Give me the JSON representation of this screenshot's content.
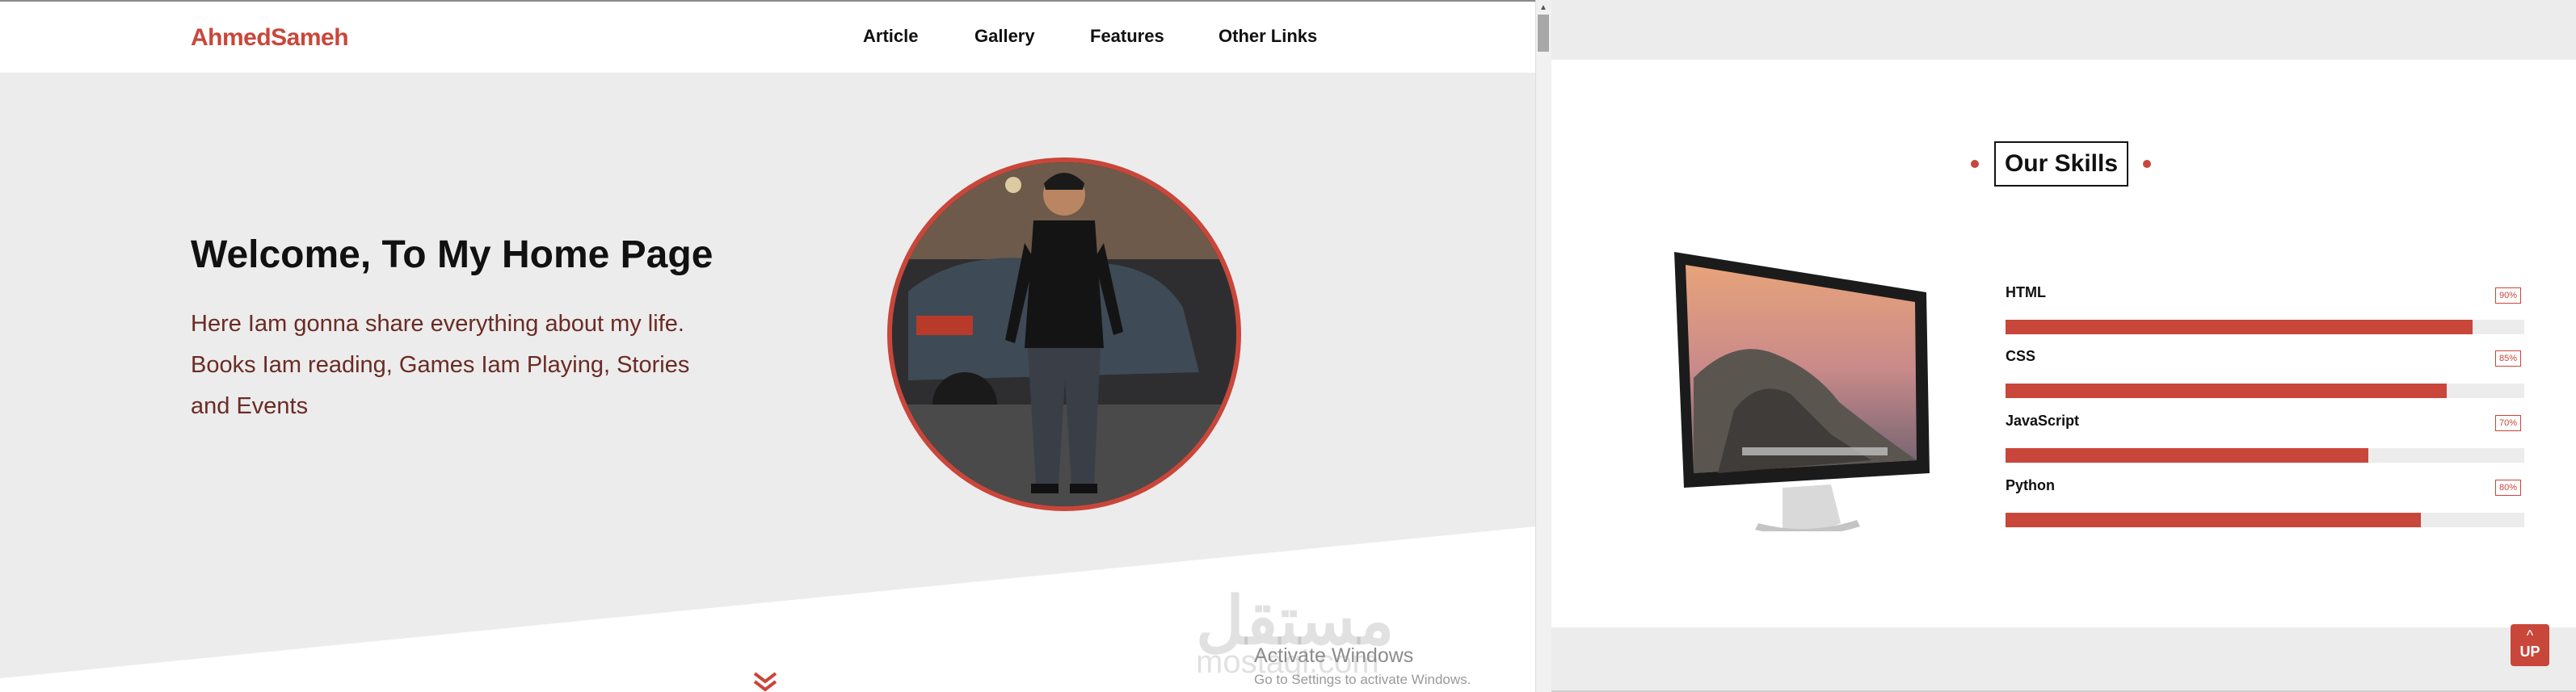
{
  "left": {
    "logo": "AhmedSameh",
    "nav": [
      "Article",
      "Gallery",
      "Features",
      "Other Links"
    ],
    "hero": {
      "title": "Welcome, To My Home Page",
      "lines": [
        "Here Iam gonna share everything about my life.",
        "Books Iam reading, Games Iam Playing, Stories",
        "and Events"
      ]
    },
    "watermark": {
      "arabic": "مستقل",
      "latin": "mostaql.com"
    },
    "activate": {
      "title": "Activate Windows",
      "sub": "Go to Settings to activate Windows."
    }
  },
  "right": {
    "skills_title": "Our Skills",
    "skills": [
      {
        "name": "HTML",
        "pct_label": "90%",
        "pct": 90
      },
      {
        "name": "CSS",
        "pct_label": "85%",
        "pct": 85
      },
      {
        "name": "JavaScript",
        "pct_label": "70%",
        "pct": 70
      },
      {
        "name": "Python",
        "pct_label": "80%",
        "pct": 80
      }
    ],
    "up_label": "UP"
  },
  "colors": {
    "accent": "#c9463a",
    "hero_text": "#6b2b24",
    "bg": "#ececec"
  },
  "icons": [
    "chevron-double-down-icon",
    "monitor-icon",
    "arrow-up-icon",
    "profile-photo"
  ]
}
